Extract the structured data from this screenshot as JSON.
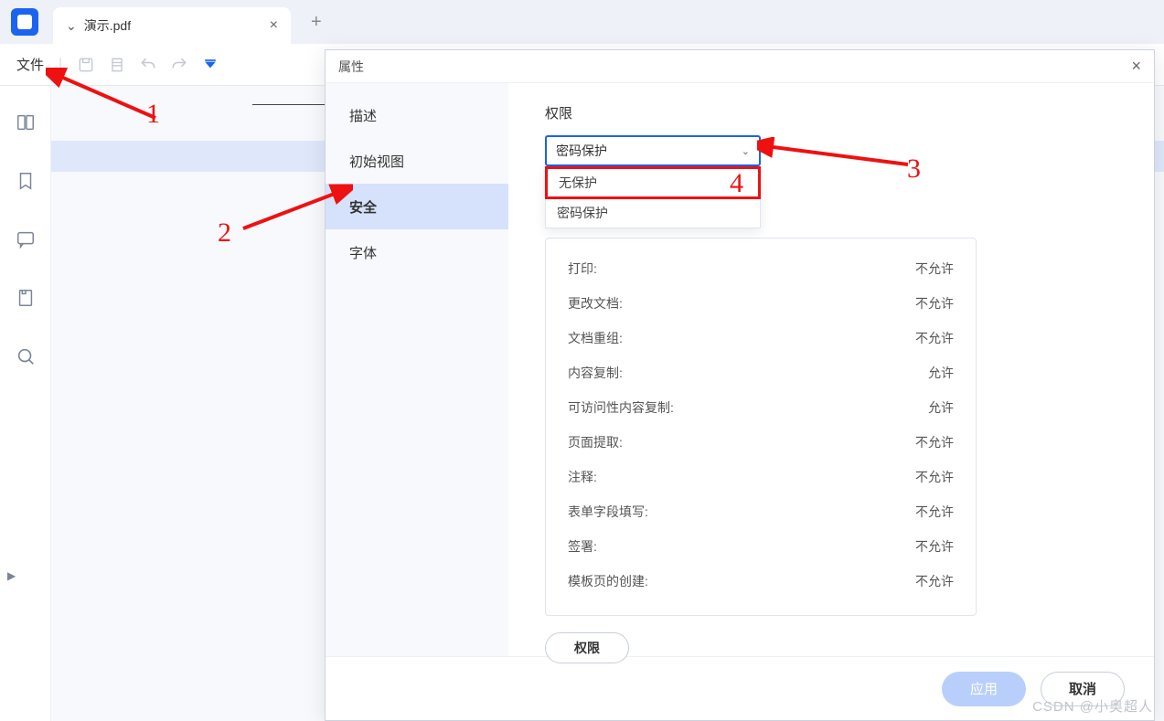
{
  "tab": {
    "title": "演示.pdf"
  },
  "toolbar": {
    "file_menu": "文件"
  },
  "dialog": {
    "title": "属性",
    "nav": {
      "desc": "描述",
      "initial_view": "初始视图",
      "security": "安全",
      "font": "字体"
    },
    "section_title": "权限",
    "select_value": "密码保护",
    "options": {
      "none": "无保护",
      "password": "密码保护"
    },
    "perm_button": "权限",
    "apply": "应用",
    "cancel": "取消"
  },
  "permissions": [
    {
      "label": "打印:",
      "value": "不允许"
    },
    {
      "label": "更改文档:",
      "value": "不允许"
    },
    {
      "label": "文档重组:",
      "value": "不允许"
    },
    {
      "label": "内容复制:",
      "value": "允许"
    },
    {
      "label": "可访问性内容复制:",
      "value": "允许"
    },
    {
      "label": "页面提取:",
      "value": "不允许"
    },
    {
      "label": "注释:",
      "value": "不允许"
    },
    {
      "label": "表单字段填写:",
      "value": "不允许"
    },
    {
      "label": "签署:",
      "value": "不允许"
    },
    {
      "label": "模板页的创建:",
      "value": "不允许"
    }
  ],
  "annotations": {
    "n1": "1",
    "n2": "2",
    "n3": "3",
    "n4": "4"
  },
  "watermark": "CSDN @小奥超人"
}
